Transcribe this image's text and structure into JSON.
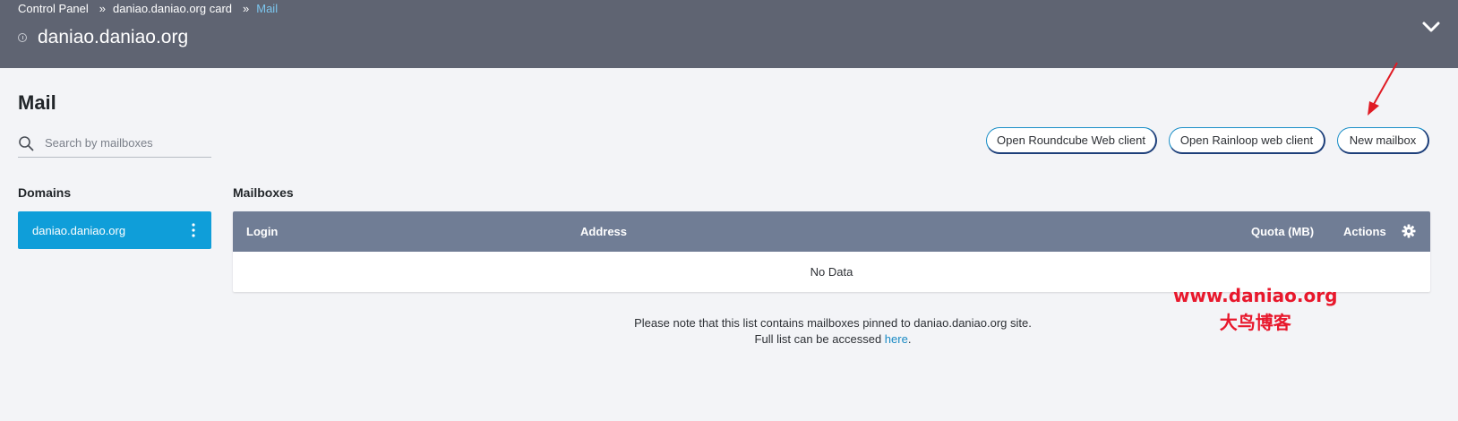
{
  "breadcrumb": {
    "items": [
      "Control Panel",
      "daniao.daniao.org card",
      "Mail"
    ],
    "separator": "»"
  },
  "header": {
    "site_title": "daniao.daniao.org",
    "background": "#5f6472"
  },
  "page": {
    "title": "Mail"
  },
  "search": {
    "placeholder": "Search by mailboxes",
    "value": ""
  },
  "toolbar": {
    "roundcube_label": "Open Roundcube Web client",
    "rainloop_label": "Open Rainloop web client",
    "new_mailbox_label": "New mailbox"
  },
  "domains": {
    "heading": "Domains",
    "items": [
      {
        "label": "daniao.daniao.org",
        "selected": true
      }
    ],
    "selected_color": "#0f9ed9"
  },
  "mailboxes": {
    "heading": "Mailboxes",
    "columns": [
      "Login",
      "Address",
      "Quota (MB)",
      "Actions"
    ],
    "rows": [],
    "empty_text": "No Data",
    "header_color": "#707d95"
  },
  "note": {
    "line1": "Please note that this list contains mailboxes pinned to daniao.daniao.org site.",
    "line2_prefix": "Full list can be accessed ",
    "link_text": "here",
    "line2_suffix": "."
  },
  "watermark": {
    "url": "www.daniao.org",
    "name": "大鸟博客",
    "color": "#e8182c"
  },
  "icons": {
    "info": "info-icon",
    "collapse": "chevron-down-icon",
    "search": "search-icon",
    "domain_menu": "kebab-menu-icon",
    "settings": "gear-icon",
    "annotation": "red-arrow"
  }
}
